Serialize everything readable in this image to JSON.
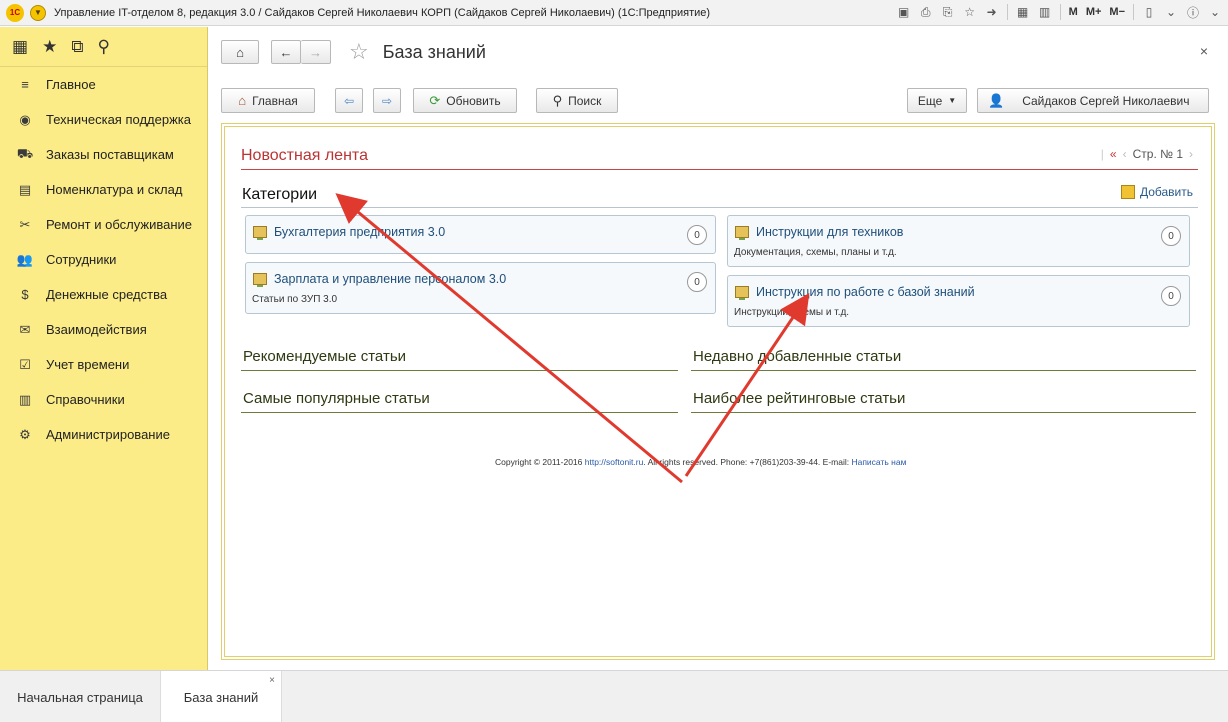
{
  "window": {
    "logo": "1С",
    "title": "Управление IT-отделом 8, редакция 3.0 / Сайдаков Сергей Николаевич КОРП (Сайдаков Сергей Николаевич)  (1С:Предприятие)",
    "tools": {
      "m": "M",
      "m_plus": "M+",
      "m_minus": "M−"
    }
  },
  "sidebar": {
    "items": [
      {
        "label": "Главное",
        "icon": "menu-lines-icon",
        "glyph": "≡"
      },
      {
        "label": "Техническая поддержка",
        "icon": "support-icon",
        "glyph": "◉"
      },
      {
        "label": "Заказы поставщикам",
        "icon": "truck-icon",
        "glyph": "⛟"
      },
      {
        "label": "Номенклатура и склад",
        "icon": "printer-icon",
        "glyph": "▤"
      },
      {
        "label": "Ремонт и обслуживание",
        "icon": "tools-icon",
        "glyph": "✂"
      },
      {
        "label": "Сотрудники",
        "icon": "users-icon",
        "glyph": "👥"
      },
      {
        "label": "Денежные средства",
        "icon": "money-bag-icon",
        "glyph": "$"
      },
      {
        "label": "Взаимодействия",
        "icon": "envelope-icon",
        "glyph": "✉"
      },
      {
        "label": "Учет времени",
        "icon": "calendar-check-icon",
        "glyph": "☑"
      },
      {
        "label": "Справочники",
        "icon": "book-icon",
        "glyph": "▥"
      },
      {
        "label": "Администрирование",
        "icon": "gear-icon",
        "glyph": "⚙"
      }
    ]
  },
  "header": {
    "title": "База знаний",
    "close": "×"
  },
  "commandbar": {
    "home_label": "Главная",
    "refresh_label": "Обновить",
    "search_label": "Поиск",
    "more_label": "Еще",
    "user_label": "Сайдаков Сергей Николаевич"
  },
  "news": {
    "title": "Новостная лента",
    "pager_first": "«",
    "pager_prev": "‹",
    "pager_label": "Стр. № 1",
    "pager_next": "›"
  },
  "categories": {
    "title": "Категории",
    "add_label": "Добавить",
    "left": [
      {
        "title": "Бухгалтерия предприятия 3.0",
        "desc": "",
        "count": "0"
      },
      {
        "title": "Зарплата и управление персоналом 3.0",
        "desc": "Статьи по ЗУП 3.0",
        "count": "0"
      }
    ],
    "right": [
      {
        "title": "Инструкции для техников",
        "desc": "Документация, схемы, планы и т.д.",
        "count": "0"
      },
      {
        "title": "Инструкция по работе с базой знаний",
        "desc": "Инструкции, схемы и т.д.",
        "count": "0"
      }
    ]
  },
  "sections": {
    "recommended": "Рекомендуемые статьи",
    "recent": "Недавно добавленные статьи",
    "popular": "Самые популярные статьи",
    "top_rated": "Наиболее рейтинговые статьи"
  },
  "footer": {
    "copyright_pre": "Copyright © 2011-2016 ",
    "site_link": "http://softonit.ru",
    "copyright_mid": ". All rights reserved. Phone: +7(861)203-39-44. E-mail: ",
    "email_link": "Написать нам"
  },
  "tabs": {
    "home": "Начальная страница",
    "kb": "База знаний",
    "close": "×"
  },
  "colors": {
    "sidebar_bg": "#fbec88",
    "news_title": "#b33333",
    "annotation_arrow": "#e03a2f"
  }
}
